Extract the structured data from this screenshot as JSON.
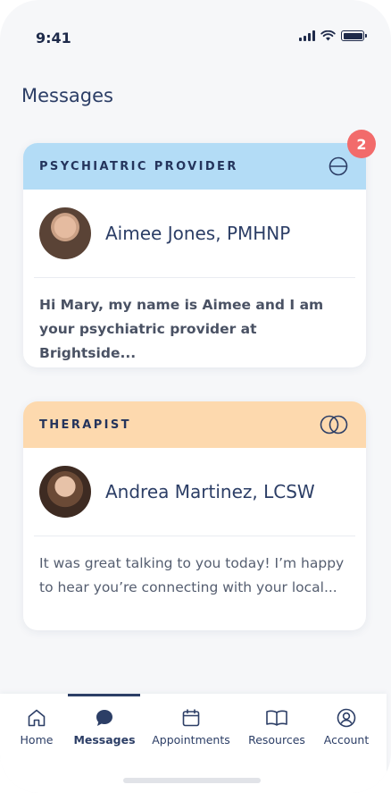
{
  "status_bar": {
    "time": "9:41"
  },
  "page": {
    "title": "Messages"
  },
  "cards": [
    {
      "type": "PSYCHIATRIC PROVIDER",
      "header_color": "#b3dcf6",
      "icon": "half-circle-icon",
      "name": "Aimee Jones, PMHNP",
      "preview": "Hi Mary, my name is Aimee and I am your psychiatric provider at Brightside...",
      "unread_count": "2"
    },
    {
      "type": "THERAPIST",
      "header_color": "#fdd9ae",
      "icon": "overlapping-circles-icon",
      "name": "Andrea Martinez, LCSW",
      "preview": "It was great talking to you today! I’m happy to hear you’re connecting with your local..."
    }
  ],
  "nav": {
    "items": [
      {
        "label": "Home",
        "icon": "home-icon"
      },
      {
        "label": "Messages",
        "icon": "chat-icon",
        "active": true
      },
      {
        "label": "Appointments",
        "icon": "calendar-icon"
      },
      {
        "label": "Resources",
        "icon": "book-icon"
      },
      {
        "label": "Account",
        "icon": "user-icon"
      }
    ]
  },
  "colors": {
    "text_primary": "#2c3e66",
    "badge": "#f26b6b",
    "background": "#f6f7f9"
  }
}
